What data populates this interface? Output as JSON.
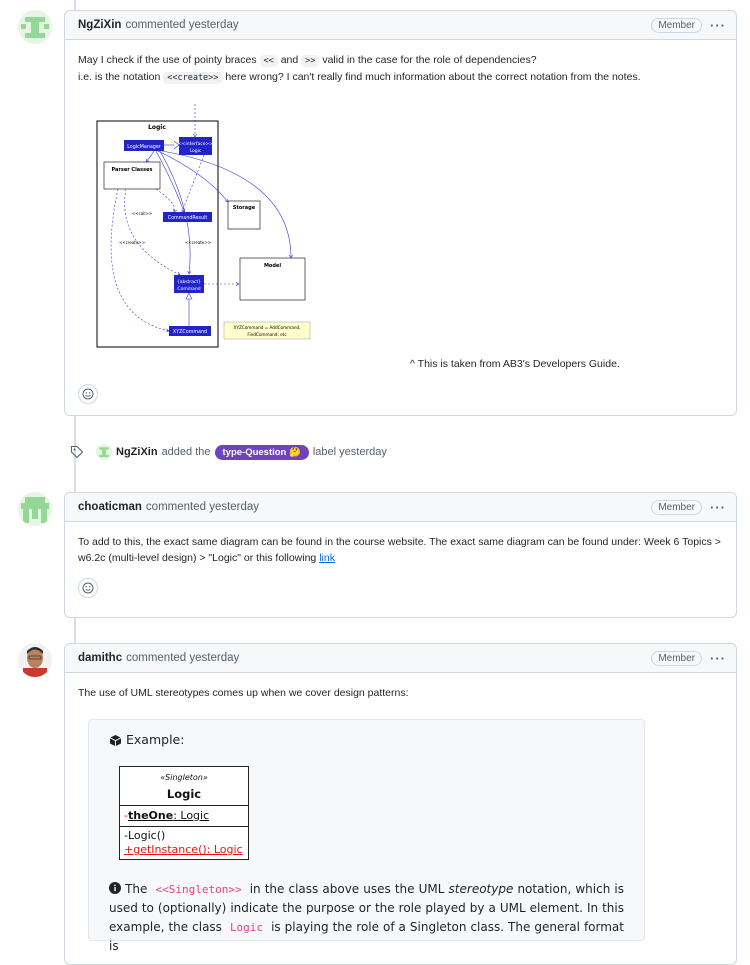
{
  "comments": [
    {
      "author": "NgZiXin",
      "action": "commented yesterday",
      "badge": "Member",
      "body": {
        "line1_prefix": "May I check if the use of pointy braces",
        "code_lt": "<<",
        "and_word": "and",
        "code_gt": ">>",
        "line1_suffix": "valid in the case for the role of dependencies?",
        "line2_prefix": "i.e. is the notation",
        "code_create": "<<create>>",
        "line2_suffix": "here wrong? I can't really find much information about the correct notation from the notes.",
        "caption": "^ This is taken from AB3's Developers Guide."
      },
      "diagram": {
        "title": "Logic",
        "logic_manager": "LogicManager",
        "interface_top": "<<interface>>",
        "interface_bottom": "Logic",
        "parser": "Parser Classes",
        "command_result": "CommandResult",
        "storage": "Storage",
        "model": "Model",
        "abstract_top": "{abstract}",
        "abstract_bottom": "Command",
        "xyz": "XYZCommand",
        "call_label": "<<call>>",
        "create_label_left": "<<create>>",
        "create_label_right": "<<create>>",
        "note_line1": "XYZCommand = AddCommand,",
        "note_line2": "FindCommand, etc"
      }
    },
    {
      "author": "choaticman",
      "action": "commented yesterday",
      "badge": "Member",
      "body": {
        "text": "To add to this, the exact same diagram can be found in the course website. The exact same diagram can be found under: Week 6 Topics > w6.2c (multi-level design) > \"Logic\" or this following",
        "link": "link"
      }
    },
    {
      "author": "damithc",
      "action": "commented yesterday",
      "badge": "Member",
      "body": {
        "intro": "The use of UML stereotypes comes up when we cover design patterns:",
        "example_title": "Example:",
        "uml_stereotype": "«Singleton»",
        "uml_name": "Logic",
        "uml_attr_vis": "-",
        "uml_attr": "theOne",
        "uml_attr_type": ":  Logic",
        "uml_op1": "-Logic()",
        "uml_op2": "+getInstance(): Logic",
        "para_prefix": "The",
        "para_code1": "<<Singleton>>",
        "para_mid1": "in the class above uses the UML",
        "para_italic": "stereotype",
        "para_mid2": "notation, which is used to (optionally) indicate the purpose or the role played by a UML element. In this example, the class",
        "para_code2": "Logic",
        "para_end": "is playing the role of a Singleton class. The general format is"
      }
    }
  ],
  "event": {
    "actor": "NgZiXin",
    "verb": "added the",
    "label": "type-Question",
    "label_emoji": "🤔",
    "suffix": "label yesterday",
    "label_color": "#6f42c1"
  },
  "icons": [
    "smiley-icon",
    "tag-icon",
    "kebab-icon",
    "cube-icon",
    "info-icon"
  ]
}
